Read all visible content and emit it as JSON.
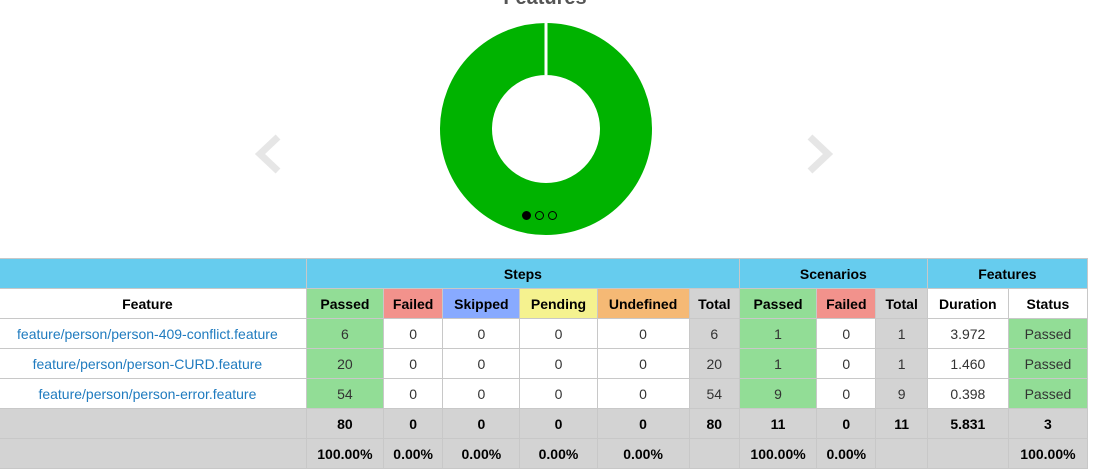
{
  "carousel": {
    "title": "Features",
    "slide_count": 3,
    "active_slide": 0,
    "colors": {
      "passed": "#00b300",
      "arrow": "#e6e6e6"
    },
    "chart_data": {
      "type": "pie",
      "title": "Features",
      "slices": [
        {
          "label": "Passed",
          "value": 3
        }
      ]
    }
  },
  "table": {
    "groups": {
      "steps": "Steps",
      "scenarios": "Scenarios",
      "features": "Features"
    },
    "headers": {
      "feature": "Feature",
      "steps": [
        "Passed",
        "Failed",
        "Skipped",
        "Pending",
        "Undefined",
        "Total"
      ],
      "scenarios": [
        "Passed",
        "Failed",
        "Total"
      ],
      "features": [
        "Duration",
        "Status"
      ]
    },
    "rows": [
      {
        "feature": "feature/person/person-409-conflict.feature",
        "steps": [
          "6",
          "0",
          "0",
          "0",
          "0",
          "6"
        ],
        "scenarios": [
          "1",
          "0",
          "1"
        ],
        "duration": "3.972",
        "status": "Passed"
      },
      {
        "feature": "feature/person/person-CURD.feature",
        "steps": [
          "20",
          "0",
          "0",
          "0",
          "0",
          "20"
        ],
        "scenarios": [
          "1",
          "0",
          "1"
        ],
        "duration": "1.460",
        "status": "Passed"
      },
      {
        "feature": "feature/person/person-error.feature",
        "steps": [
          "54",
          "0",
          "0",
          "0",
          "0",
          "54"
        ],
        "scenarios": [
          "9",
          "0",
          "9"
        ],
        "duration": "0.398",
        "status": "Passed"
      }
    ],
    "totals": {
      "steps": [
        "80",
        "0",
        "0",
        "0",
        "0",
        "80"
      ],
      "scenarios": [
        "11",
        "0",
        "11"
      ],
      "duration": "5.831",
      "status": "3"
    },
    "percents": {
      "steps": [
        "100.00%",
        "0.00%",
        "0.00%",
        "0.00%",
        "0.00%",
        ""
      ],
      "scenarios": [
        "100.00%",
        "0.00%",
        ""
      ],
      "duration": "",
      "status": "100.00%"
    }
  }
}
